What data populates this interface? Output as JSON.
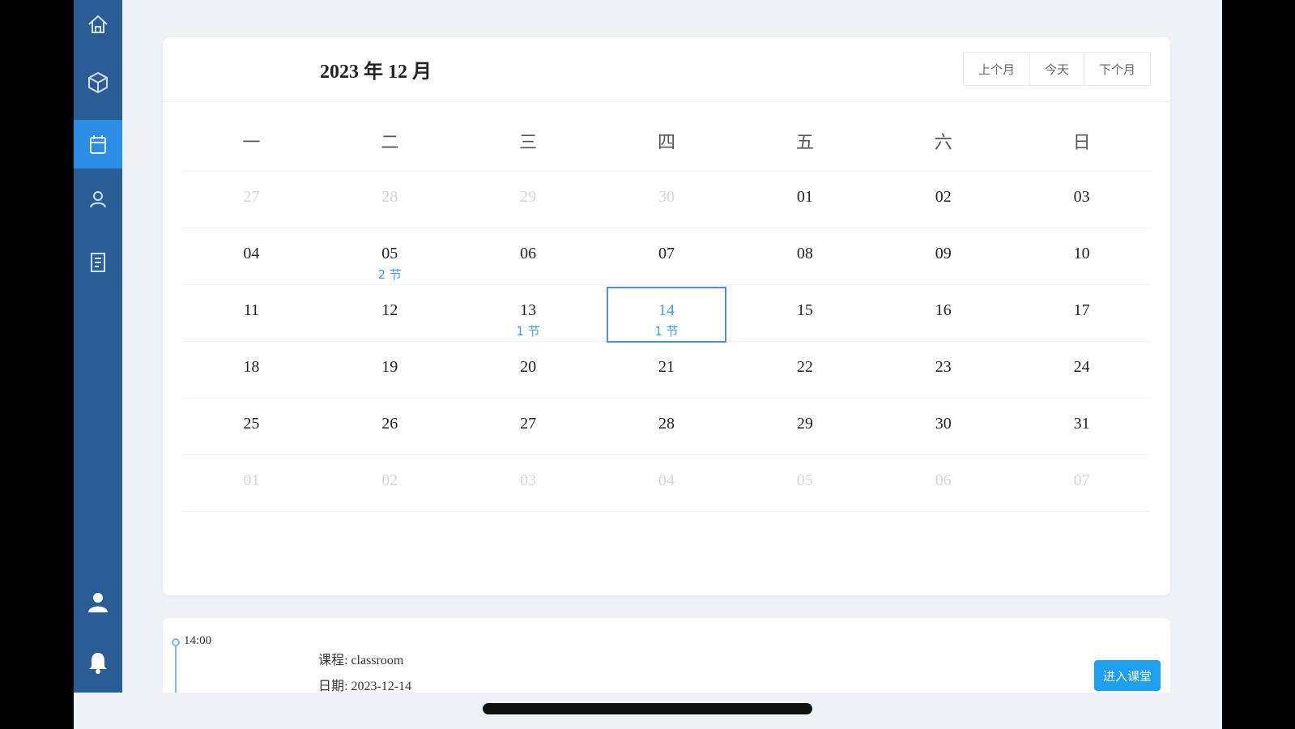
{
  "sidebar": {
    "items": [
      {
        "name": "home-icon",
        "active": false
      },
      {
        "name": "cube-icon",
        "active": false
      },
      {
        "name": "calendar-icon",
        "active": true
      },
      {
        "name": "user-outline-icon",
        "active": false
      },
      {
        "name": "document-icon",
        "active": false
      }
    ],
    "bottom": [
      {
        "name": "profile-icon"
      },
      {
        "name": "bell-icon"
      }
    ]
  },
  "calendar": {
    "title": "2023 年 12 月",
    "nav": {
      "prev": "上个月",
      "today": "今天",
      "next": "下个月"
    },
    "weekdays": [
      "一",
      "二",
      "三",
      "四",
      "五",
      "六",
      "日"
    ],
    "weeks": [
      [
        {
          "d": "27",
          "dim": true
        },
        {
          "d": "28",
          "dim": true
        },
        {
          "d": "29",
          "dim": true
        },
        {
          "d": "30",
          "dim": true
        },
        {
          "d": "01"
        },
        {
          "d": "02"
        },
        {
          "d": "03"
        }
      ],
      [
        {
          "d": "04"
        },
        {
          "d": "05",
          "lessons": "2 节"
        },
        {
          "d": "06"
        },
        {
          "d": "07"
        },
        {
          "d": "08"
        },
        {
          "d": "09"
        },
        {
          "d": "10"
        }
      ],
      [
        {
          "d": "11"
        },
        {
          "d": "12"
        },
        {
          "d": "13",
          "lessons": "1 节"
        },
        {
          "d": "14",
          "lessons": "1 节",
          "selected": true
        },
        {
          "d": "15"
        },
        {
          "d": "16"
        },
        {
          "d": "17"
        }
      ],
      [
        {
          "d": "18"
        },
        {
          "d": "19"
        },
        {
          "d": "20"
        },
        {
          "d": "21"
        },
        {
          "d": "22"
        },
        {
          "d": "23"
        },
        {
          "d": "24"
        }
      ],
      [
        {
          "d": "25"
        },
        {
          "d": "26"
        },
        {
          "d": "27"
        },
        {
          "d": "28"
        },
        {
          "d": "29"
        },
        {
          "d": "30"
        },
        {
          "d": "31"
        }
      ],
      [
        {
          "d": "01",
          "dim": true
        },
        {
          "d": "02",
          "dim": true
        },
        {
          "d": "03",
          "dim": true
        },
        {
          "d": "04",
          "dim": true
        },
        {
          "d": "05",
          "dim": true
        },
        {
          "d": "06",
          "dim": true
        },
        {
          "d": "07",
          "dim": true
        }
      ]
    ]
  },
  "schedule": {
    "time": "14:00",
    "course": "课程: classroom",
    "date": "日期: 2023-12-14",
    "enter_label": "进入课堂"
  }
}
